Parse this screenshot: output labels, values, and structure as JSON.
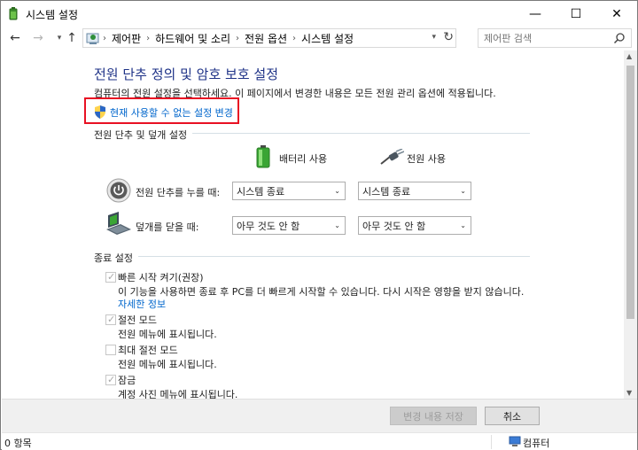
{
  "window": {
    "title": "시스템 설정",
    "minimize": "—",
    "maximize": "☐",
    "close": "✕"
  },
  "nav": {
    "back": "←",
    "forward": "→",
    "recent": "▾",
    "up": "↑",
    "breadcrumbs": [
      "제어판",
      "하드웨어 및 소리",
      "전원 옵션",
      "시스템 설정"
    ],
    "separator": "›",
    "dropdown": "▾",
    "refresh": "↻",
    "search_placeholder": "제어판 검색"
  },
  "page": {
    "title": "전원 단추 정의 및 암호 보호 설정",
    "description": "컴퓨터의 전원 설정을 선택하세요. 이 페이지에서 변경한 내용은 모든 전원 관리 옵션에 적용됩니다.",
    "change_link": "현재 사용할 수 없는 설정 변경"
  },
  "power_section": {
    "heading": "전원 단추 및 덮개 설정",
    "battery_label": "배터리 사용",
    "plugged_label": "전원 사용",
    "rows": [
      {
        "label": "전원 단추를 누를 때:",
        "battery": "시스템 종료",
        "plugged": "시스템 종료"
      },
      {
        "label": "덮개를 닫을 때:",
        "battery": "아무 것도 안 함",
        "plugged": "아무 것도 안 함"
      }
    ],
    "dropdown_glyph": "⌄"
  },
  "shutdown_section": {
    "heading": "종료 설정",
    "items": [
      {
        "label": "빠른 시작 켜기(권장)",
        "checked": true,
        "desc": "이 기능을 사용하면 종료 후 PC를 더 빠르게 시작할 수 있습니다. 다시 시작은 영향을 받지 않습니다.",
        "link": "자세한 정보"
      },
      {
        "label": "절전 모드",
        "checked": true,
        "desc": "전원 메뉴에 표시됩니다."
      },
      {
        "label": "최대 절전 모드",
        "checked": false,
        "desc": "전원 메뉴에 표시됩니다."
      },
      {
        "label": "잠금",
        "checked": true,
        "desc": "계정 사진 메뉴에 표시됩니다."
      }
    ]
  },
  "footer": {
    "save": "변경 내용 저장",
    "cancel": "취소"
  },
  "status": {
    "items": "0 항목",
    "location": "컴퓨터"
  },
  "colors": {
    "title_blue": "#1e3287",
    "link_blue": "#0066cc",
    "highlight_red": "#e81123"
  }
}
